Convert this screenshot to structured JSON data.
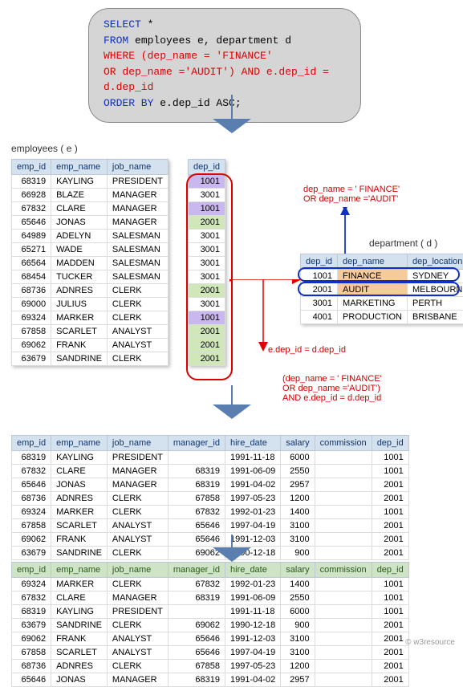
{
  "sql": {
    "l1a": "SELECT",
    "l1b": " *",
    "l2a": "FROM ",
    "l2b": "employees e, department d",
    "l3": "WHERE (dep_name = 'FINANCE'",
    "l4": "OR dep_name ='AUDIT') AND e.dep_id = d.dep_id",
    "l5a": "ORDER BY ",
    "l5b": "e.dep_id ASC",
    "l5c": ";"
  },
  "labels": {
    "employees": "employees ( e )",
    "department": "department ( d )",
    "footer": "© w3resource"
  },
  "annot": {
    "where_cond": "dep_name = ' FINANCE'\nOR dep_name ='AUDIT'",
    "join_cond": "e.dep_id = d.dep_id",
    "full_cond": "(dep_name = ' FINANCE'\nOR dep_name ='AUDIT')\nAND e.dep_id = d.dep_id"
  },
  "emp_headers": [
    "emp_id",
    "emp_name",
    "job_name",
    "dep_id"
  ],
  "employees": [
    {
      "emp_id": 68319,
      "emp_name": "KAYLING",
      "job_name": "PRESIDENT",
      "dep_id": 1001,
      "hl": "purple"
    },
    {
      "emp_id": 66928,
      "emp_name": "BLAZE",
      "job_name": "MANAGER",
      "dep_id": 3001,
      "hl": ""
    },
    {
      "emp_id": 67832,
      "emp_name": "CLARE",
      "job_name": "MANAGER",
      "dep_id": 1001,
      "hl": "purple"
    },
    {
      "emp_id": 65646,
      "emp_name": "JONAS",
      "job_name": "MANAGER",
      "dep_id": 2001,
      "hl": "green"
    },
    {
      "emp_id": 64989,
      "emp_name": "ADELYN",
      "job_name": "SALESMAN",
      "dep_id": 3001,
      "hl": ""
    },
    {
      "emp_id": 65271,
      "emp_name": "WADE",
      "job_name": "SALESMAN",
      "dep_id": 3001,
      "hl": ""
    },
    {
      "emp_id": 66564,
      "emp_name": "MADDEN",
      "job_name": "SALESMAN",
      "dep_id": 3001,
      "hl": ""
    },
    {
      "emp_id": 68454,
      "emp_name": "TUCKER",
      "job_name": "SALESMAN",
      "dep_id": 3001,
      "hl": ""
    },
    {
      "emp_id": 68736,
      "emp_name": "ADNRES",
      "job_name": "CLERK",
      "dep_id": 2001,
      "hl": "green"
    },
    {
      "emp_id": 69000,
      "emp_name": "JULIUS",
      "job_name": "CLERK",
      "dep_id": 3001,
      "hl": ""
    },
    {
      "emp_id": 69324,
      "emp_name": "MARKER",
      "job_name": "CLERK",
      "dep_id": 1001,
      "hl": "purple"
    },
    {
      "emp_id": 67858,
      "emp_name": "SCARLET",
      "job_name": "ANALYST",
      "dep_id": 2001,
      "hl": "green"
    },
    {
      "emp_id": 69062,
      "emp_name": "FRANK",
      "job_name": "ANALYST",
      "dep_id": 2001,
      "hl": "green"
    },
    {
      "emp_id": 63679,
      "emp_name": "SANDRINE",
      "job_name": "CLERK",
      "dep_id": 2001,
      "hl": "green"
    }
  ],
  "dept_headers": [
    "dep_id",
    "dep_name",
    "dep_location"
  ],
  "departments": [
    {
      "dep_id": 1001,
      "dep_name": "FINANCE",
      "dep_location": "SYDNEY",
      "hl": true
    },
    {
      "dep_id": 2001,
      "dep_name": "AUDIT",
      "dep_location": "MELBOURNE",
      "hl": true
    },
    {
      "dep_id": 3001,
      "dep_name": "MARKETING",
      "dep_location": "PERTH",
      "hl": false
    },
    {
      "dep_id": 4001,
      "dep_name": "PRODUCTION",
      "dep_location": "BRISBANE",
      "hl": false
    }
  ],
  "result_headers": [
    "emp_id",
    "emp_name",
    "job_name",
    "manager_id",
    "hire_date",
    "salary",
    "commission",
    "dep_id"
  ],
  "result1": [
    {
      "emp_id": 68319,
      "emp_name": "KAYLING",
      "job_name": "PRESIDENT",
      "manager_id": "",
      "hire_date": "1991-11-18",
      "salary": 6000,
      "commission": "",
      "dep_id": 1001
    },
    {
      "emp_id": 67832,
      "emp_name": "CLARE",
      "job_name": "MANAGER",
      "manager_id": 68319,
      "hire_date": "1991-06-09",
      "salary": 2550,
      "commission": "",
      "dep_id": 1001
    },
    {
      "emp_id": 65646,
      "emp_name": "JONAS",
      "job_name": "MANAGER",
      "manager_id": 68319,
      "hire_date": "1991-04-02",
      "salary": 2957,
      "commission": "",
      "dep_id": 2001
    },
    {
      "emp_id": 68736,
      "emp_name": "ADNRES",
      "job_name": "CLERK",
      "manager_id": 67858,
      "hire_date": "1997-05-23",
      "salary": 1200,
      "commission": "",
      "dep_id": 2001
    },
    {
      "emp_id": 69324,
      "emp_name": "MARKER",
      "job_name": "CLERK",
      "manager_id": 67832,
      "hire_date": "1992-01-23",
      "salary": 1400,
      "commission": "",
      "dep_id": 1001
    },
    {
      "emp_id": 67858,
      "emp_name": "SCARLET",
      "job_name": "ANALYST",
      "manager_id": 65646,
      "hire_date": "1997-04-19",
      "salary": 3100,
      "commission": "",
      "dep_id": 2001
    },
    {
      "emp_id": 69062,
      "emp_name": "FRANK",
      "job_name": "ANALYST",
      "manager_id": 65646,
      "hire_date": "1991-12-03",
      "salary": 3100,
      "commission": "",
      "dep_id": 2001
    },
    {
      "emp_id": 63679,
      "emp_name": "SANDRINE",
      "job_name": "CLERK",
      "manager_id": 69062,
      "hire_date": "1990-12-18",
      "salary": 900,
      "commission": "",
      "dep_id": 2001
    }
  ],
  "result2": [
    {
      "emp_id": 69324,
      "emp_name": "MARKER",
      "job_name": "CLERK",
      "manager_id": 67832,
      "hire_date": "1992-01-23",
      "salary": 1400,
      "commission": "",
      "dep_id": 1001
    },
    {
      "emp_id": 67832,
      "emp_name": "CLARE",
      "job_name": "MANAGER",
      "manager_id": 68319,
      "hire_date": "1991-06-09",
      "salary": 2550,
      "commission": "",
      "dep_id": 1001
    },
    {
      "emp_id": 68319,
      "emp_name": "KAYLING",
      "job_name": "PRESIDENT",
      "manager_id": "",
      "hire_date": "1991-11-18",
      "salary": 6000,
      "commission": "",
      "dep_id": 1001
    },
    {
      "emp_id": 63679,
      "emp_name": "SANDRINE",
      "job_name": "CLERK",
      "manager_id": 69062,
      "hire_date": "1990-12-18",
      "salary": 900,
      "commission": "",
      "dep_id": 2001
    },
    {
      "emp_id": 69062,
      "emp_name": "FRANK",
      "job_name": "ANALYST",
      "manager_id": 65646,
      "hire_date": "1991-12-03",
      "salary": 3100,
      "commission": "",
      "dep_id": 2001
    },
    {
      "emp_id": 67858,
      "emp_name": "SCARLET",
      "job_name": "ANALYST",
      "manager_id": 65646,
      "hire_date": "1997-04-19",
      "salary": 3100,
      "commission": "",
      "dep_id": 2001
    },
    {
      "emp_id": 68736,
      "emp_name": "ADNRES",
      "job_name": "CLERK",
      "manager_id": 67858,
      "hire_date": "1997-05-23",
      "salary": 1200,
      "commission": "",
      "dep_id": 2001
    },
    {
      "emp_id": 65646,
      "emp_name": "JONAS",
      "job_name": "MANAGER",
      "manager_id": 68319,
      "hire_date": "1991-04-02",
      "salary": 2957,
      "commission": "",
      "dep_id": 2001
    }
  ]
}
